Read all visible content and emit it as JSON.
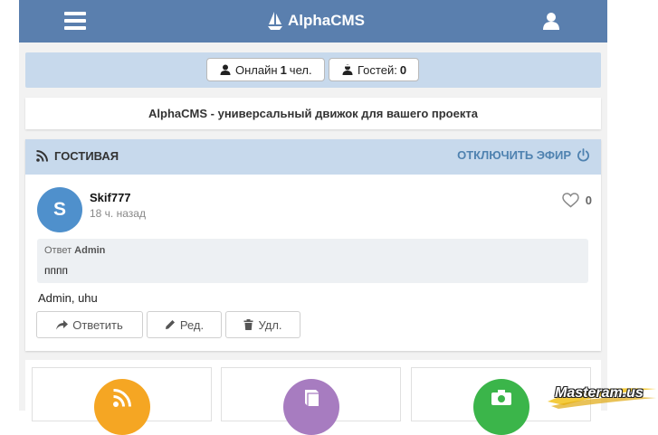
{
  "header": {
    "brand": "AlphaCMS",
    "menu_icon": "hamburger-menu-icon",
    "brand_icon": "sailboat-logo-icon",
    "user_icon": "user-icon",
    "background_color": "#5a7fae"
  },
  "online": {
    "online_label": "Онлайн",
    "online_count": "1",
    "online_unit": "чел.",
    "guests_label": "Гостей:",
    "guests_count": "0",
    "background_color": "#c7d9ec"
  },
  "intro": {
    "text": "AlphaCMS - универсальный движок для вашего проекта"
  },
  "guestbook": {
    "title": "ГОСТИВАЯ",
    "action": "ОТКЛЮЧИТЬ ЭФИР",
    "title_icon": "rss-icon",
    "action_icon": "power-icon",
    "post": {
      "avatar_letter": "S",
      "author": "Skif777",
      "time": "18 ч. назад",
      "likes": "0",
      "reply_label": "Ответ",
      "reply_author": "Admin",
      "reply_text": "пппп",
      "message": "Admin, uhu",
      "buttons": {
        "reply": "Ответить",
        "edit": "Ред.",
        "delete": "Удл."
      }
    }
  },
  "tiles": [
    {
      "icon": "rss-icon",
      "color": "#f5a623"
    },
    {
      "icon": "book-icon",
      "color": "#a77cc0"
    },
    {
      "icon": "camera-icon",
      "color": "#3bb54a"
    }
  ],
  "watermark": "Masteram.us",
  "colors": {
    "accent": "#4f82b0",
    "avatar": "#4f90cc"
  }
}
